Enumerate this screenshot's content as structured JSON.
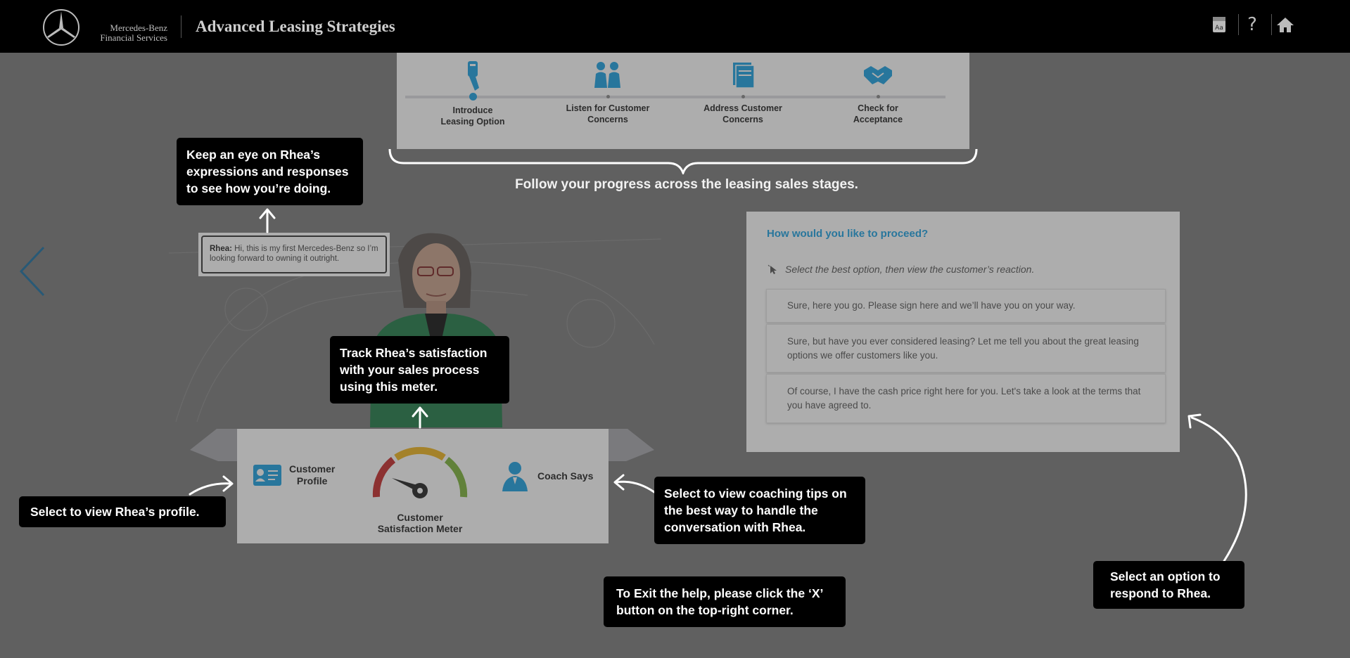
{
  "header": {
    "brand_line1": "Mercedes-Benz",
    "brand_line2": "Financial Services",
    "title": "Advanced Leasing Strategies",
    "buttons": [
      {
        "icon": "glossary-icon"
      },
      {
        "icon": "help-icon",
        "label": "?"
      },
      {
        "icon": "home-icon"
      }
    ]
  },
  "stages": {
    "items": [
      {
        "label_line1": "Introduce",
        "label_line2": "Leasing Option",
        "icon": "key-fob-icon",
        "active": true
      },
      {
        "label_line1": "Listen for Customer",
        "label_line2": "Concerns",
        "icon": "people-talking-icon",
        "active": false
      },
      {
        "label_line1": "Address Customer",
        "label_line2": "Concerns",
        "icon": "documents-icon",
        "active": false
      },
      {
        "label_line1": "Check for",
        "label_line2": "Acceptance",
        "icon": "handshake-icon",
        "active": false
      }
    ],
    "caption": "Follow your progress across the leasing sales stages."
  },
  "speech": {
    "speaker": "Rhea:",
    "text": "Hi, this is my first Mercedes-Benz so I’m looking forward to owning it outright."
  },
  "meter_bar": {
    "profile_line1": "Customer",
    "profile_line2": "Profile",
    "meter_line1": "Customer",
    "meter_line2": "Satisfaction Meter",
    "coach_label": "Coach Says"
  },
  "question": {
    "title": "How would you like to proceed?",
    "instruction": "Select the best option, then view the customer’s reaction.",
    "options": [
      "Sure, here you go. Please sign here and we’ll have you on your way.",
      "Sure, but have you ever considered leasing? Let me tell you about the great leasing options we offer customers like you.",
      "Of course, I have the cash price right here for you. Let's take a look at the terms that you have agreed to."
    ]
  },
  "callouts": {
    "expressions": "Keep an eye on Rhea’s expressions and responses to see how you’re doing.",
    "meter": "Track Rhea’s satisfaction with your sales process using this meter.",
    "profile": "Select to view Rhea’s profile.",
    "coach": "Select to view coaching tips on the best way to handle the conversation with Rhea.",
    "exit": "To Exit the help, please click the ‘X’ button on the top-right corner.",
    "option": "Select an option to respond to Rhea."
  },
  "colors": {
    "accent": "#1ba1e2",
    "header_bg": "#000000",
    "overlay_bg": "#7a7a7a",
    "callout_bg": "#000000"
  }
}
